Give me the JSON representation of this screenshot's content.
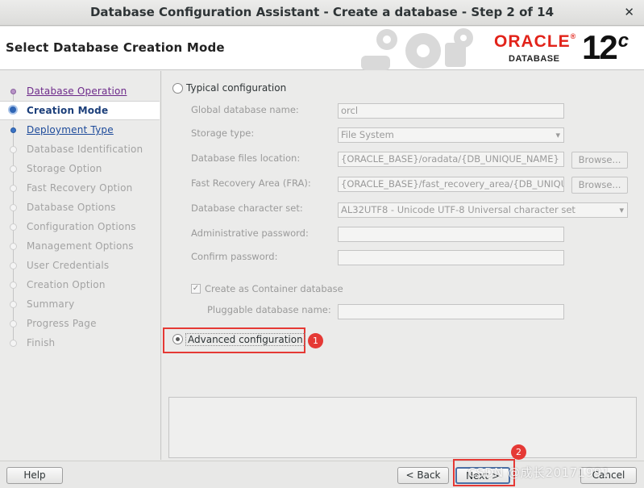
{
  "window": {
    "title": "Database Configuration Assistant - Create a database - Step 2 of 14",
    "close_glyph": "✕"
  },
  "header": {
    "page_title": "Select Database Creation Mode",
    "logo_brand": "ORACLE",
    "logo_registered": "®",
    "logo_product": "DATABASE",
    "logo_version": "12",
    "logo_version_suffix": "c"
  },
  "nav": {
    "items": [
      {
        "label": "Database Operation",
        "state": "done"
      },
      {
        "label": "Creation Mode",
        "state": "current"
      },
      {
        "label": "Deployment Type",
        "state": "link"
      },
      {
        "label": "Database Identification",
        "state": "disabled"
      },
      {
        "label": "Storage Option",
        "state": "disabled"
      },
      {
        "label": "Fast Recovery Option",
        "state": "disabled"
      },
      {
        "label": "Database Options",
        "state": "disabled"
      },
      {
        "label": "Configuration Options",
        "state": "disabled"
      },
      {
        "label": "Management Options",
        "state": "disabled"
      },
      {
        "label": "User Credentials",
        "state": "disabled"
      },
      {
        "label": "Creation Option",
        "state": "disabled"
      },
      {
        "label": "Summary",
        "state": "disabled"
      },
      {
        "label": "Progress Page",
        "state": "disabled"
      },
      {
        "label": "Finish",
        "state": "disabled"
      }
    ]
  },
  "typical": {
    "label": "Typical configuration",
    "global_db_name_label": "Global database name:",
    "global_db_name_value": "orcl",
    "storage_type_label": "Storage type:",
    "storage_type_value": "File System",
    "db_files_location_label": "Database files location:",
    "db_files_location_value": "{ORACLE_BASE}/oradata/{DB_UNIQUE_NAME}",
    "fra_label": "Fast Recovery Area (FRA):",
    "fra_value": "{ORACLE_BASE}/fast_recovery_area/{DB_UNIQUE_NAME}",
    "charset_label": "Database character set:",
    "charset_value": "AL32UTF8 - Unicode UTF-8 Universal character set",
    "admin_password_label": "Administrative password:",
    "admin_password_value": "",
    "confirm_password_label": "Confirm password:",
    "confirm_password_value": "",
    "browse_label": "Browse...",
    "container_db_label": "Create as Container database",
    "container_db_checked": true,
    "pluggable_db_label": "Pluggable database name:",
    "pluggable_db_value": ""
  },
  "advanced": {
    "label": "Advanced configuration",
    "selected": true
  },
  "annotations": {
    "marker1": "1",
    "marker2": "2"
  },
  "footer": {
    "help_label": "Help",
    "back_label": "< Back",
    "next_label": "Next >",
    "cancel_label": "Cancel"
  },
  "watermark": "CSDN @成长20171991",
  "colors": {
    "highlight": "#e53935",
    "oracle_red": "#e2231a",
    "nav_current": "#1c3f7a"
  }
}
